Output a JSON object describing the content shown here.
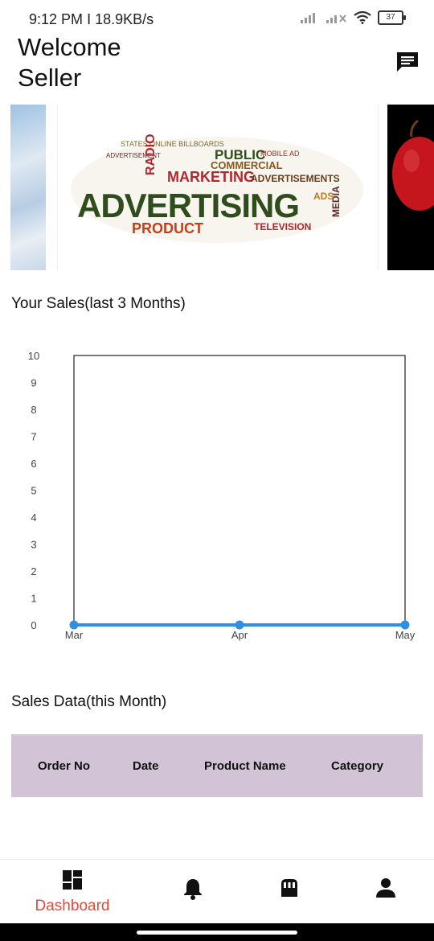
{
  "status_bar": {
    "time": "9:12 PM",
    "separator": "I",
    "speed": "18.9KB/s",
    "battery": "37"
  },
  "header": {
    "welcome_line1": "Welcome",
    "welcome_line2": "Seller",
    "chat_icon": "chat-icon"
  },
  "banner": {
    "words": {
      "advertising": "ADVERTISING",
      "marketing": "MARKETING",
      "commercial": "COMMERCIAL",
      "public": "PUBLIC",
      "product": "PRODUCT",
      "television": "TELEVISION",
      "radio": "RADIO",
      "media": "MEDIA",
      "advertisements": "ADVERTISEMENTS",
      "ads": "ADS"
    }
  },
  "sales_section": {
    "title": "Your Sales(last 3 Months)"
  },
  "chart_data": {
    "type": "line",
    "title": "",
    "xlabel": "",
    "ylabel": "",
    "categories": [
      "Mar",
      "Apr",
      "May"
    ],
    "series": [
      {
        "values": [
          0,
          0,
          0
        ]
      }
    ],
    "ylim": [
      0,
      10
    ],
    "yticks": [
      0,
      1,
      2,
      3,
      4,
      5,
      6,
      7,
      8,
      9,
      10
    ],
    "grid": false,
    "line_color": "#2f8fe0"
  },
  "sales_data": {
    "title": "Sales Data(this Month)",
    "columns": [
      "Order No",
      "Date",
      "Product Name",
      "Category"
    ],
    "header_color": "#d2c4d6"
  },
  "bottom_nav": {
    "items": [
      {
        "icon": "dashboard-icon",
        "label": "Dashboard",
        "active": true
      },
      {
        "icon": "bell-icon",
        "label": ""
      },
      {
        "icon": "store-icon",
        "label": ""
      },
      {
        "icon": "person-icon",
        "label": ""
      }
    ],
    "active_color": "#e14b3b"
  }
}
